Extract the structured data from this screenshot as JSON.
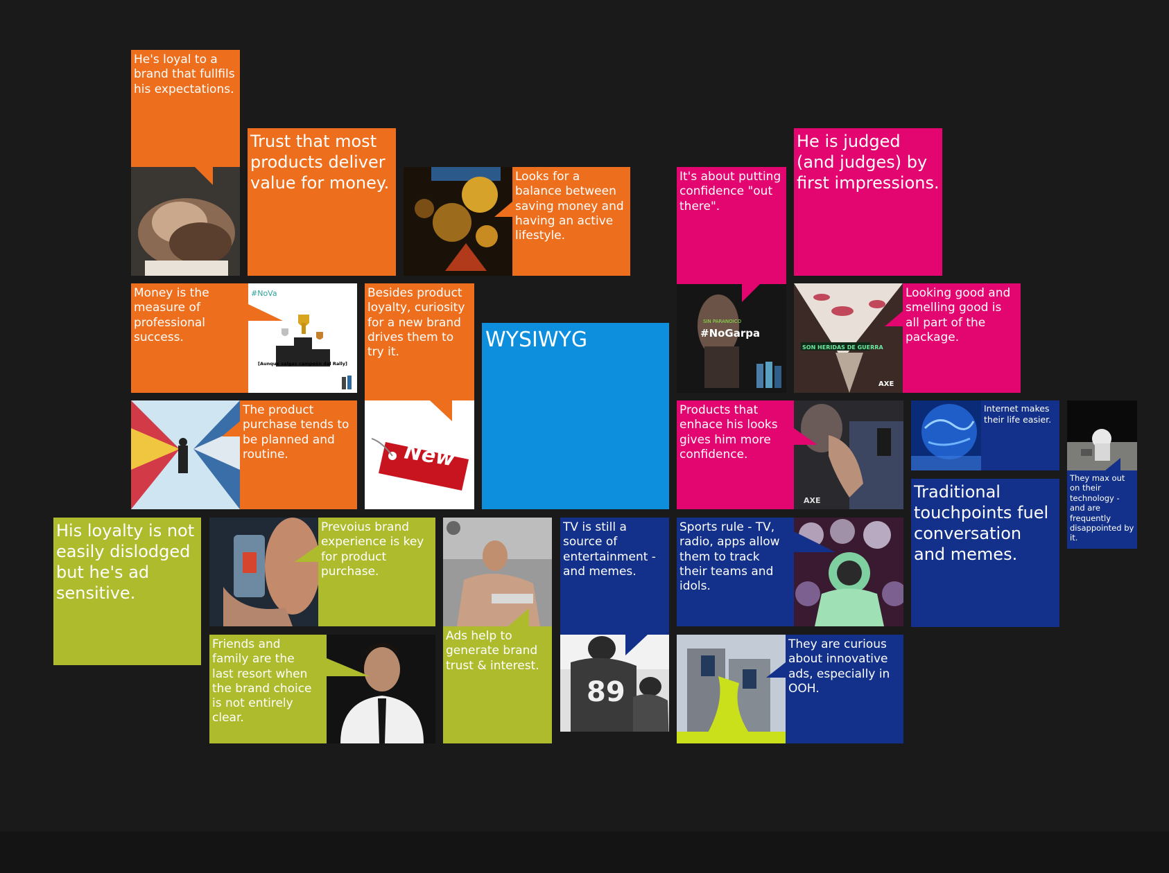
{
  "tiles": {
    "loyal_brand": "He's loyal to a brand that fullfils his expectations.",
    "trust_value": "Trust that most products deliver value for money.",
    "balance": "Looks for a balance between saving money and having an active lifestyle.",
    "confidence_out": "It's about putting confidence \"out there\".",
    "judged": "He is judged (and judges) by first impressions.",
    "money_success": "Money is the measure of professional success.",
    "curiosity": "Besides product loyalty, curiosity for a new brand drives them to try it.",
    "wysiwyg": "WYSIWYG",
    "looking_good": "Looking good and smelling good is all part of the package.",
    "planned": "The product purchase tends to be planned and routine.",
    "enhance_looks": "Products that enhace his looks gives him more confidence.",
    "internet": "Internet makes their life easier.",
    "technology": "They max out on their technology - and are frequently disappointed by it.",
    "traditional": "Traditional touchpoints fuel conversation and memes.",
    "ad_sensitive": "His loyalty is not easily dislodged but he's ad sensitive.",
    "previous_exp": "Prevoius brand experience is key for product purchase.",
    "tv_source": "TV is still a source of entertainment - and memes.",
    "sports": "Sports rule - TV, radio, apps allow them to track their teams and idols.",
    "friends_family": "Friends and family are the last resort when the brand choice is not entirely clear.",
    "ads_trust": "Ads help to generate brand trust & interest.",
    "curious_ooh": "They are curious about innovative ads, especially in OOH."
  },
  "image_text": {
    "nova_tag": "#NoVa",
    "nova_caption": "[Aunque salgas campeón del Rally]",
    "new_tag": "New",
    "nogarpa_tag": "#NoGarpa",
    "nogarpa_small": "SIN PARANOICO",
    "heridas_tag": "SON HERIDAS DE GUERRA",
    "axe_logo": "AXE",
    "jersey_number": "89"
  },
  "colors": {
    "orange": "#ed6f1d",
    "pink": "#e30570",
    "blue": "#0d8fdd",
    "navy": "#13318a",
    "lime": "#adbb2d",
    "background": "#1b1a1b"
  }
}
